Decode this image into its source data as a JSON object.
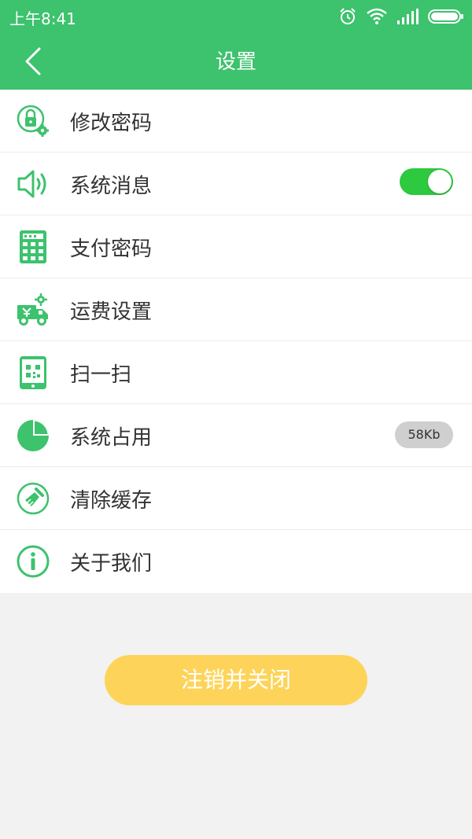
{
  "status_bar": {
    "time": "上午8:41",
    "icons": [
      "alarm-icon",
      "wifi-icon",
      "signal-icon",
      "battery-icon"
    ]
  },
  "nav": {
    "title": "设置",
    "back_icon": "chevron-left-icon"
  },
  "colors": {
    "accent": "#3dc26d",
    "toggle_on": "#2dc93f",
    "button": "#fdd459",
    "background": "#f2f2f2"
  },
  "settings": [
    {
      "label": "修改密码",
      "icon": "lock-settings-icon"
    },
    {
      "label": "系统消息",
      "icon": "speaker-icon",
      "toggle_on": true
    },
    {
      "label": "支付密码",
      "icon": "keypad-icon"
    },
    {
      "label": "运费设置",
      "icon": "delivery-truck-icon"
    },
    {
      "label": "扫一扫",
      "icon": "scan-phone-icon"
    },
    {
      "label": "系统占用",
      "icon": "pie-chart-icon",
      "badge": "58Kb"
    },
    {
      "label": "清除缓存",
      "icon": "broom-icon"
    },
    {
      "label": "关于我们",
      "icon": "info-icon"
    }
  ],
  "logout_button": "注销并关闭"
}
